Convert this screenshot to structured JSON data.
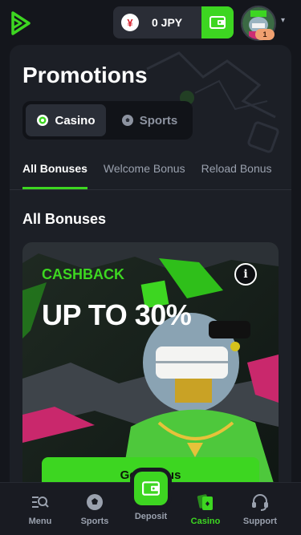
{
  "header": {
    "currency_symbol": "¥",
    "balance": "0 JPY",
    "avatar_level": "1"
  },
  "page": {
    "title": "Promotions",
    "segment": [
      {
        "label": "Casino",
        "active": true
      },
      {
        "label": "Sports",
        "active": false
      }
    ],
    "tabs": [
      {
        "label": "All Bonuses",
        "active": true
      },
      {
        "label": "Welcome Bonus",
        "active": false
      },
      {
        "label": "Reload Bonus",
        "active": false
      }
    ],
    "section_title": "All Bonuses"
  },
  "promo": {
    "label": "CASHBACK",
    "headline": "UP TO 30%",
    "info_glyph": "i",
    "cta": "Get Bonus"
  },
  "bottom_nav": {
    "items": [
      {
        "label": "Menu",
        "icon": "menu-search-icon"
      },
      {
        "label": "Sports",
        "icon": "soccer-ball-icon"
      },
      {
        "label": "Deposit",
        "icon": "wallet-icon"
      },
      {
        "label": "Casino",
        "icon": "cards-icon",
        "active": true
      },
      {
        "label": "Support",
        "icon": "headset-icon"
      }
    ]
  },
  "colors": {
    "accent": "#3dd621",
    "background": "#14161c",
    "card": "#1c1f26"
  }
}
